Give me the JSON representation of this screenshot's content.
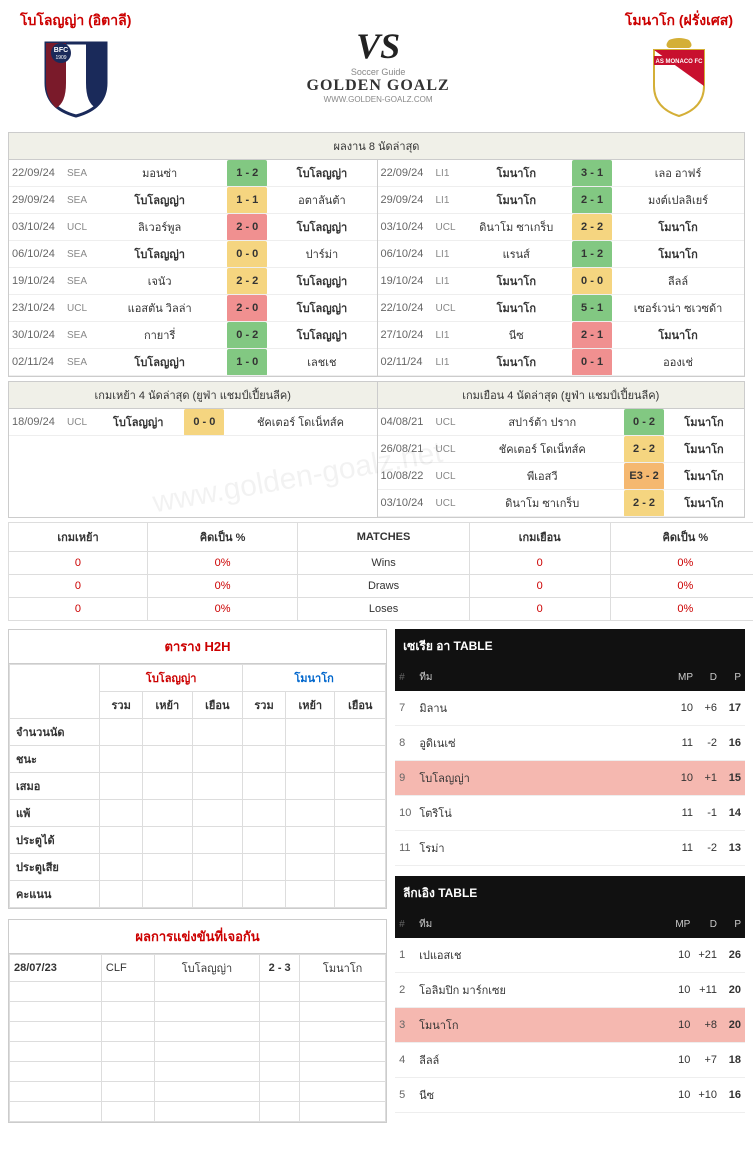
{
  "header": {
    "home_name": "โบโลญญ่า (อิตาลี)",
    "away_name": "โมนาโก (ฝรั่งเศส)",
    "vs": "VS",
    "logo_top": "Soccer Guide",
    "logo": "GOLDEN GOALZ",
    "logo_sub": "WWW.GOLDEN-GOALZ.COM"
  },
  "recent8": {
    "title": "ผลงาน 8 นัดล่าสุด",
    "home": [
      {
        "date": "22/09/24",
        "comp": "SEA",
        "t1": "มอนซ่า",
        "sc": "1 - 2",
        "cls": "score-g",
        "t2": "โบโลญญ่า",
        "bold": "t2"
      },
      {
        "date": "29/09/24",
        "comp": "SEA",
        "t1": "โบโลญญ่า",
        "sc": "1 - 1",
        "cls": "score-y",
        "t2": "อตาลันต้า",
        "bold": "t1"
      },
      {
        "date": "03/10/24",
        "comp": "UCL",
        "t1": "ลิเวอร์พูล",
        "sc": "2 - 0",
        "cls": "score-r",
        "t2": "โบโลญญ่า",
        "bold": "t2"
      },
      {
        "date": "06/10/24",
        "comp": "SEA",
        "t1": "โบโลญญ่า",
        "sc": "0 - 0",
        "cls": "score-y",
        "t2": "ปาร์ม่า",
        "bold": "t1"
      },
      {
        "date": "19/10/24",
        "comp": "SEA",
        "t1": "เจนัว",
        "sc": "2 - 2",
        "cls": "score-y",
        "t2": "โบโลญญ่า",
        "bold": "t2"
      },
      {
        "date": "23/10/24",
        "comp": "UCL",
        "t1": "แอสตัน วิลล่า",
        "sc": "2 - 0",
        "cls": "score-r",
        "t2": "โบโลญญ่า",
        "bold": "t2"
      },
      {
        "date": "30/10/24",
        "comp": "SEA",
        "t1": "กายารี่",
        "sc": "0 - 2",
        "cls": "score-g",
        "t2": "โบโลญญ่า",
        "bold": "t2"
      },
      {
        "date": "02/11/24",
        "comp": "SEA",
        "t1": "โบโลญญ่า",
        "sc": "1 - 0",
        "cls": "score-g",
        "t2": "เลชเช",
        "bold": "t1"
      }
    ],
    "away": [
      {
        "date": "22/09/24",
        "comp": "LI1",
        "t1": "โมนาโก",
        "sc": "3 - 1",
        "cls": "score-g",
        "t2": "เลอ อาฟร์",
        "bold": "t1"
      },
      {
        "date": "29/09/24",
        "comp": "LI1",
        "t1": "โมนาโก",
        "sc": "2 - 1",
        "cls": "score-g",
        "t2": "มงต์เปลลิเยร์",
        "bold": "t1"
      },
      {
        "date": "03/10/24",
        "comp": "UCL",
        "t1": "ดินาโม ซาเกร็บ",
        "sc": "2 - 2",
        "cls": "score-y",
        "t2": "โมนาโก",
        "bold": "t2"
      },
      {
        "date": "06/10/24",
        "comp": "LI1",
        "t1": "แรนส์",
        "sc": "1 - 2",
        "cls": "score-g",
        "t2": "โมนาโก",
        "bold": "t2"
      },
      {
        "date": "19/10/24",
        "comp": "LI1",
        "t1": "โมนาโก",
        "sc": "0 - 0",
        "cls": "score-y",
        "t2": "ลีลล์",
        "bold": "t1"
      },
      {
        "date": "22/10/24",
        "comp": "UCL",
        "t1": "โมนาโก",
        "sc": "5 - 1",
        "cls": "score-g",
        "t2": "เซอร์เวน่า ซเวซด้า",
        "bold": "t1"
      },
      {
        "date": "27/10/24",
        "comp": "LI1",
        "t1": "นีซ",
        "sc": "2 - 1",
        "cls": "score-r",
        "t2": "โมนาโก",
        "bold": "t2"
      },
      {
        "date": "02/11/24",
        "comp": "LI1",
        "t1": "โมนาโก",
        "sc": "0 - 1",
        "cls": "score-r",
        "t2": "อองเช่",
        "bold": "t1"
      }
    ]
  },
  "ucl4": {
    "home_title": "เกมเหย้า 4 นัดล่าสุด (ยูฟ่า แชมป์เปี้ยนลีค)",
    "away_title": "เกมเยือน 4 นัดล่าสุด (ยูฟ่า แชมป์เปี้ยนลีค)",
    "home": [
      {
        "date": "18/09/24",
        "comp": "UCL",
        "t1": "โบโลญญ่า",
        "sc": "0 - 0",
        "cls": "score-y",
        "t2": "ชัคเตอร์ โดเน็ทส์ค",
        "bold": "t1"
      }
    ],
    "away": [
      {
        "date": "04/08/21",
        "comp": "UCL",
        "t1": "สปาร์ต้า ปราก",
        "sc": "0 - 2",
        "cls": "score-g",
        "t2": "โมนาโก",
        "bold": "t2"
      },
      {
        "date": "26/08/21",
        "comp": "UCL",
        "t1": "ชัคเตอร์ โดเน็ทส์ค",
        "sc": "2 - 2",
        "cls": "score-y",
        "t2": "โมนาโก",
        "bold": "t2"
      },
      {
        "date": "10/08/22",
        "comp": "UCL",
        "t1": "พีเอสวี",
        "sc": "E3 - 2",
        "cls": "score-o",
        "t2": "โมนาโก",
        "bold": "t2"
      },
      {
        "date": "03/10/24",
        "comp": "UCL",
        "t1": "ดินาโม ซาเกร็บ",
        "sc": "2 - 2",
        "cls": "score-y",
        "t2": "โมนาโก",
        "bold": "t2"
      }
    ]
  },
  "stats": {
    "headers": {
      "home": "เกมเหย้า",
      "pct": "คิดเป็น %",
      "matches": "MATCHES",
      "away": "เกมเยือน",
      "pct2": "คิดเป็น %"
    },
    "rows": [
      {
        "h": "0",
        "hp": "0%",
        "label": "Wins",
        "a": "0",
        "ap": "0%"
      },
      {
        "h": "0",
        "hp": "0%",
        "label": "Draws",
        "a": "0",
        "ap": "0%"
      },
      {
        "h": "0",
        "hp": "0%",
        "label": "Loses",
        "a": "0",
        "ap": "0%"
      }
    ]
  },
  "h2h": {
    "title": "ตาราง H2H",
    "team_home": "โบโลญญ่า",
    "team_away": "โมนาโก",
    "sub": {
      "all": "รวม",
      "home": "เหย้า",
      "away": "เยือน"
    },
    "rows": [
      "จำนวนนัด",
      "ชนะ",
      "เสมอ",
      "แพ้",
      "ประตูได้",
      "ประตูเสีย",
      "คะแนน"
    ]
  },
  "meetings": {
    "title": "ผลการแข่งขันที่เจอกัน",
    "rows": [
      {
        "date": "28/07/23",
        "comp": "CLF",
        "t1": "โบโลญญ่า",
        "sc": "2 - 3",
        "t2": "โมนาโก"
      }
    ],
    "empty_rows": 7
  },
  "leagues": {
    "serieA": {
      "title": "เซเรีย อา TABLE",
      "cols": {
        "rank": "#",
        "team": "ทีม",
        "mp": "MP",
        "d": "D",
        "p": "P"
      },
      "rows": [
        {
          "rank": "7",
          "team": "มิลาน",
          "mp": "10",
          "d": "+6",
          "p": "17",
          "hl": false
        },
        {
          "rank": "8",
          "team": "อูดิเนเซ่",
          "mp": "11",
          "d": "-2",
          "p": "16",
          "hl": false
        },
        {
          "rank": "9",
          "team": "โบโลญญ่า",
          "mp": "10",
          "d": "+1",
          "p": "15",
          "hl": true
        },
        {
          "rank": "10",
          "team": "โตริโน่",
          "mp": "11",
          "d": "-1",
          "p": "14",
          "hl": false
        },
        {
          "rank": "11",
          "team": "โรม่า",
          "mp": "11",
          "d": "-2",
          "p": "13",
          "hl": false
        }
      ]
    },
    "ligue1": {
      "title": "ลีกเอิง TABLE",
      "cols": {
        "rank": "#",
        "team": "ทีม",
        "mp": "MP",
        "d": "D",
        "p": "P"
      },
      "rows": [
        {
          "rank": "1",
          "team": "เปแอสเช",
          "mp": "10",
          "d": "+21",
          "p": "26",
          "hl": false
        },
        {
          "rank": "2",
          "team": "โอลิมปิก มาร์กเซย",
          "mp": "10",
          "d": "+11",
          "p": "20",
          "hl": false
        },
        {
          "rank": "3",
          "team": "โมนาโก",
          "mp": "10",
          "d": "+8",
          "p": "20",
          "hl": true
        },
        {
          "rank": "4",
          "team": "ลีลล์",
          "mp": "10",
          "d": "+7",
          "p": "18",
          "hl": false
        },
        {
          "rank": "5",
          "team": "นีซ",
          "mp": "10",
          "d": "+10",
          "p": "16",
          "hl": false
        }
      ]
    }
  },
  "watermark": "www.golden-goalz.net"
}
